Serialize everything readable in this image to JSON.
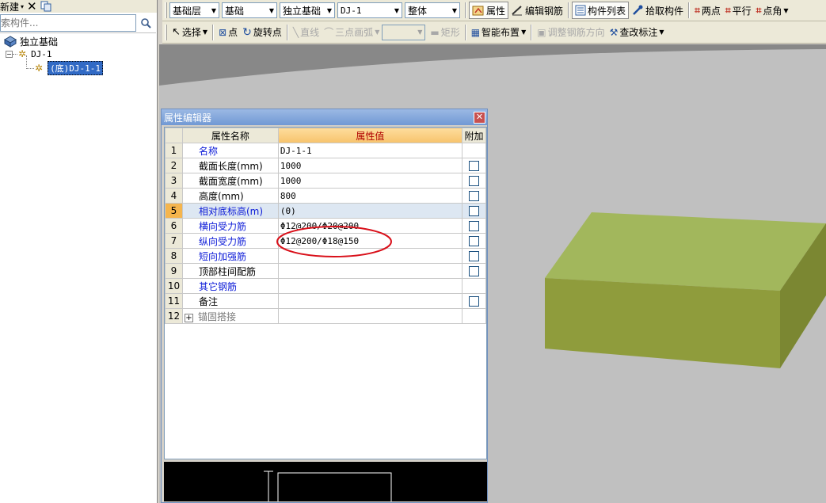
{
  "left_panel": {
    "new_button": "新建",
    "search_placeholder": "索构件...",
    "tree": {
      "root": "独立基础",
      "child": "DJ-1",
      "selected": "(底)DJ-1-1"
    }
  },
  "toolbar1": {
    "floor": "基础层",
    "category": "基础",
    "type": "独立基础",
    "component": "DJ-1",
    "scope": "整体",
    "buttons": [
      "属性",
      "编辑钢筋",
      "构件列表",
      "拾取构件",
      "两点",
      "平行",
      "点角"
    ]
  },
  "toolbar2": {
    "select": "选择",
    "point": "点",
    "rotate_point": "旋转点",
    "line": "直线",
    "three_point_arc": "三点画弧",
    "rect": "矩形",
    "smart_layout": "智能布置",
    "adjust_rebar": "调整钢筋方向",
    "modify_annotation": "查改标注"
  },
  "prop_editor": {
    "title": "属性编辑器",
    "headers": {
      "name": "属性名称",
      "value": "属性值",
      "extra": "附加"
    },
    "rows": [
      {
        "idx": "1",
        "name": "名称",
        "value": "DJ-1-1",
        "has_check": false,
        "blue": true
      },
      {
        "idx": "2",
        "name": "截面长度(mm)",
        "value": "1000",
        "has_check": true,
        "blue": false
      },
      {
        "idx": "3",
        "name": "截面宽度(mm)",
        "value": "1000",
        "has_check": true,
        "blue": false
      },
      {
        "idx": "4",
        "name": "高度(mm)",
        "value": "800",
        "has_check": true,
        "blue": false
      },
      {
        "idx": "5",
        "name": "相对底标高(m)",
        "value": "(0)",
        "has_check": true,
        "blue": true
      },
      {
        "idx": "6",
        "name": "横向受力筋",
        "value": "Φ12@200/Φ20@200",
        "has_check": true,
        "blue": true
      },
      {
        "idx": "7",
        "name": "纵向受力筋",
        "value": "Φ12@200/Φ18@150",
        "has_check": true,
        "blue": true
      },
      {
        "idx": "8",
        "name": "短向加强筋",
        "value": "",
        "has_check": true,
        "blue": true
      },
      {
        "idx": "9",
        "name": "顶部柱间配筋",
        "value": "",
        "has_check": true,
        "blue": false
      },
      {
        "idx": "10",
        "name": "其它钢筋",
        "value": "",
        "has_check": false,
        "blue": true
      },
      {
        "idx": "11",
        "name": "备注",
        "value": "",
        "has_check": true,
        "blue": false
      },
      {
        "idx": "12",
        "name": "锚固搭接",
        "value": "",
        "has_check": false,
        "blue": false
      }
    ]
  },
  "colors": {
    "block_top": "#a2b75c",
    "block_front": "#8f9c3c",
    "block_side": "#7b8732",
    "annotation_ellipse": "#d9101a"
  }
}
